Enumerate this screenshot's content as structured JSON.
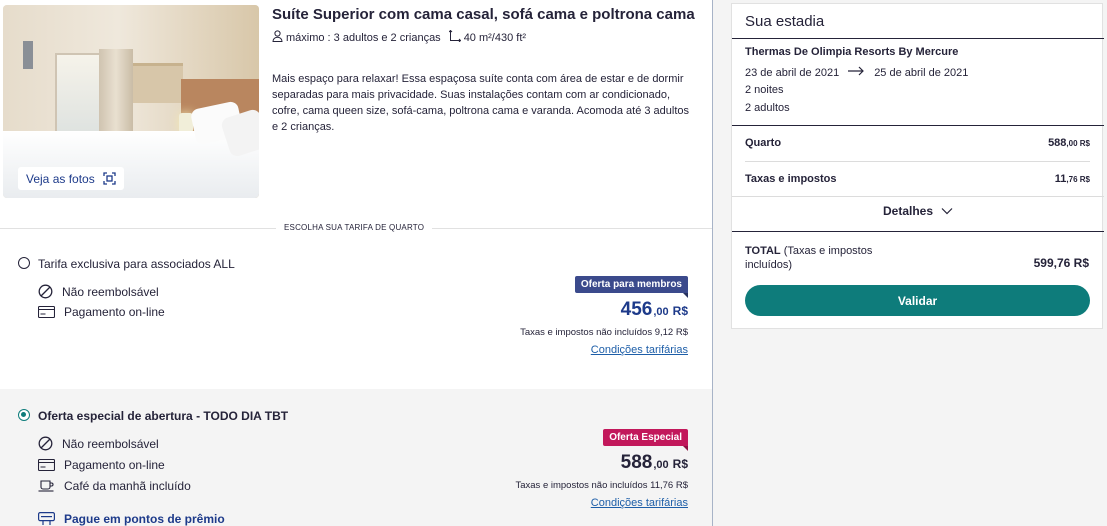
{
  "room": {
    "title": "Suíte Superior com cama casal, sofá cama e poltrona cama",
    "capacity": "máximo : 3 adultos e 2 crianças",
    "area": "40 m²/430 ft²",
    "description": "Mais espaço para relaxar! Essa espaçosa suíte conta com área de estar e de dormir separadas para mais privacidade. Suas instalações contam com ar condicionado, cofre, cama queen size, sofá-cama, poltrona cama e varanda. Acomoda até 3 adultos e 2 crianças.",
    "photos_label": "Veja as fotos"
  },
  "section_label": "ESCOLHA SUA TARIFA DE QUARTO",
  "rates": [
    {
      "name": "Tarifa exclusiva para associados ALL",
      "selected": false,
      "features": [
        "Não reembolsável",
        "Pagamento on-line"
      ],
      "badge": "Oferta para membros",
      "price_int": "456",
      "price_cents": ",00",
      "currency": "R$",
      "tax_note": "Taxas e impostos não incluídos 9,12 R$",
      "conditions": "Condições tarifárias"
    },
    {
      "name": "Oferta especial de abertura - TODO DIA TBT",
      "selected": true,
      "features": [
        "Não reembolsável",
        "Pagamento on-line",
        "Café da manhã incluído"
      ],
      "points_link": "Pague em pontos de prêmio",
      "badge": "Oferta Especial",
      "price_int": "588",
      "price_cents": ",00",
      "currency": "R$",
      "tax_note": "Taxas e impostos não incluídos 11,76 R$",
      "conditions": "Condições tarifárias"
    }
  ],
  "summary": {
    "title": "Sua estadia",
    "hotel": "Thermas De Olimpia Resorts By Mercure",
    "checkin": "23 de abril de 2021",
    "checkout": "25 de abril de 2021",
    "nights": "2 noites",
    "guests": "2 adultos",
    "room_label": "Quarto",
    "room_int": "588",
    "room_cents": ",00 R$",
    "tax_label": "Taxas e impostos",
    "tax_int": "11",
    "tax_cents": ",76 R$",
    "details_label": "Detalhes",
    "total_label": "TOTAL",
    "total_sub": " (Taxas e impostos incluídos)",
    "total_amount": "599,76 R$",
    "validate_label": "Validar"
  },
  "colors": {
    "accent_teal": "#0e7c7b",
    "member_badge": "#3b4a8c",
    "special_badge": "#c2185b",
    "link_blue": "#1d5ea8"
  }
}
